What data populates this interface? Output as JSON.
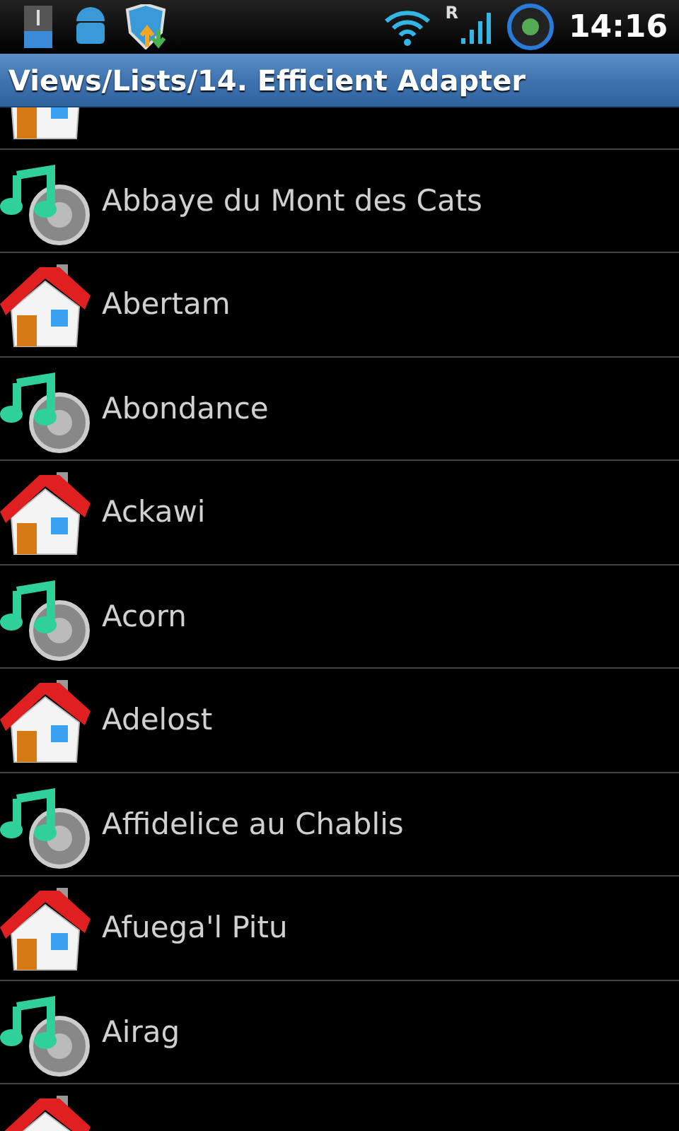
{
  "status_bar": {
    "roaming": "R",
    "time": "14:16"
  },
  "title_bar": {
    "title": "Views/Lists/14. Efficient Adapter"
  },
  "list": [
    {
      "kind": "house"
    },
    {
      "kind": "music",
      "label": "Abbaye du Mont des Cats"
    },
    {
      "kind": "house",
      "label": "Abertam"
    },
    {
      "kind": "music",
      "label": "Abondance"
    },
    {
      "kind": "house",
      "label": "Ackawi"
    },
    {
      "kind": "music",
      "label": "Acorn"
    },
    {
      "kind": "house",
      "label": "Adelost"
    },
    {
      "kind": "music",
      "label": "Affidelice au Chablis"
    },
    {
      "kind": "house",
      "label": "Afuega'l Pitu"
    },
    {
      "kind": "music",
      "label": "Airag"
    },
    {
      "kind": "house"
    }
  ]
}
